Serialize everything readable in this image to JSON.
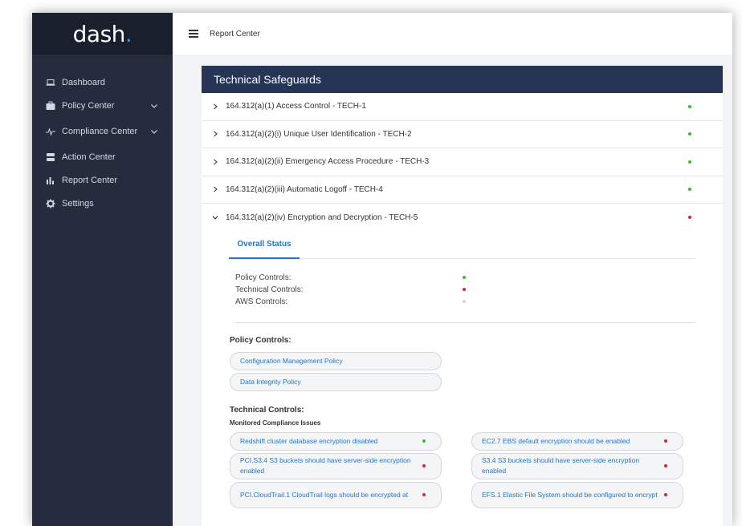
{
  "app": {
    "logo": "dash",
    "logo_dot": "."
  },
  "sidebar": {
    "items": [
      {
        "label": "Dashboard",
        "icon": "laptop-icon",
        "has_chevron": false
      },
      {
        "label": "Policy Center",
        "icon": "briefcase-icon",
        "has_chevron": true
      },
      {
        "label": "Compliance Center",
        "icon": "pulse-icon",
        "has_chevron": true
      },
      {
        "label": "Action Center",
        "icon": "server-icon",
        "has_chevron": false
      },
      {
        "label": "Report Center",
        "icon": "bar-chart-icon",
        "has_chevron": false
      },
      {
        "label": "Settings",
        "icon": "gear-icon",
        "has_chevron": false
      }
    ]
  },
  "topbar": {
    "title": "Report Center"
  },
  "panel": {
    "title": "Technical Safeguards",
    "rows": [
      {
        "label": "164.312(a)(1) Access Control - TECH-1",
        "status": "green",
        "expanded": false
      },
      {
        "label": "164.312(a)(2)(i) Unique User Identification - TECH-2",
        "status": "green",
        "expanded": false
      },
      {
        "label": "164.312(a)(2)(ii) Emergency Access Procedure - TECH-3",
        "status": "green",
        "expanded": false
      },
      {
        "label": "164.312(a)(2)(iii) Automatic Logoff - TECH-4",
        "status": "green",
        "expanded": false
      },
      {
        "label": "164.312(a)(2)(iv) Encryption and Decryption - TECH-5",
        "status": "red",
        "expanded": true
      }
    ],
    "expanded": {
      "tab_label": "Overall Status",
      "status_lines": [
        {
          "label": "Policy Controls:",
          "status": "green"
        },
        {
          "label": "Technical Controls:",
          "status": "red"
        },
        {
          "label": "AWS Controls:",
          "status": "grey"
        }
      ],
      "policy_title": "Policy Controls:",
      "policies": [
        "Configuration Management Policy",
        "Data Integrity Policy"
      ],
      "technical_title": "Technical Controls:",
      "monitored_title": "Monitored Compliance Issues",
      "issues": [
        {
          "text": "Redshift cluster database encryption disabled",
          "status": "green",
          "tall": false
        },
        {
          "text": "EC2.7 EBS default encryption should be enabled",
          "status": "red",
          "tall": false
        },
        {
          "text": "PCI.S3.4 S3 buckets should have server-side encryption enabled",
          "status": "red",
          "tall": true
        },
        {
          "text": "S3.4 S3 buckets should have server-side encryption enabled",
          "status": "red",
          "tall": true
        },
        {
          "text": "PCI.CloudTrail.1 CloudTrail logs should be encrypted at",
          "status": "red",
          "tall": true
        },
        {
          "text": "EFS.1 Elastic File System should be configured to encrypt",
          "status": "red",
          "tall": true
        }
      ]
    }
  },
  "colors": {
    "sidebar_bg": "#262c3e",
    "logo_bg": "#1a1f2e",
    "header_bg": "#263456",
    "link": "#2176c9",
    "green": "#3dbb2f",
    "red": "#d9262d",
    "grey": "#d0d3d8"
  }
}
